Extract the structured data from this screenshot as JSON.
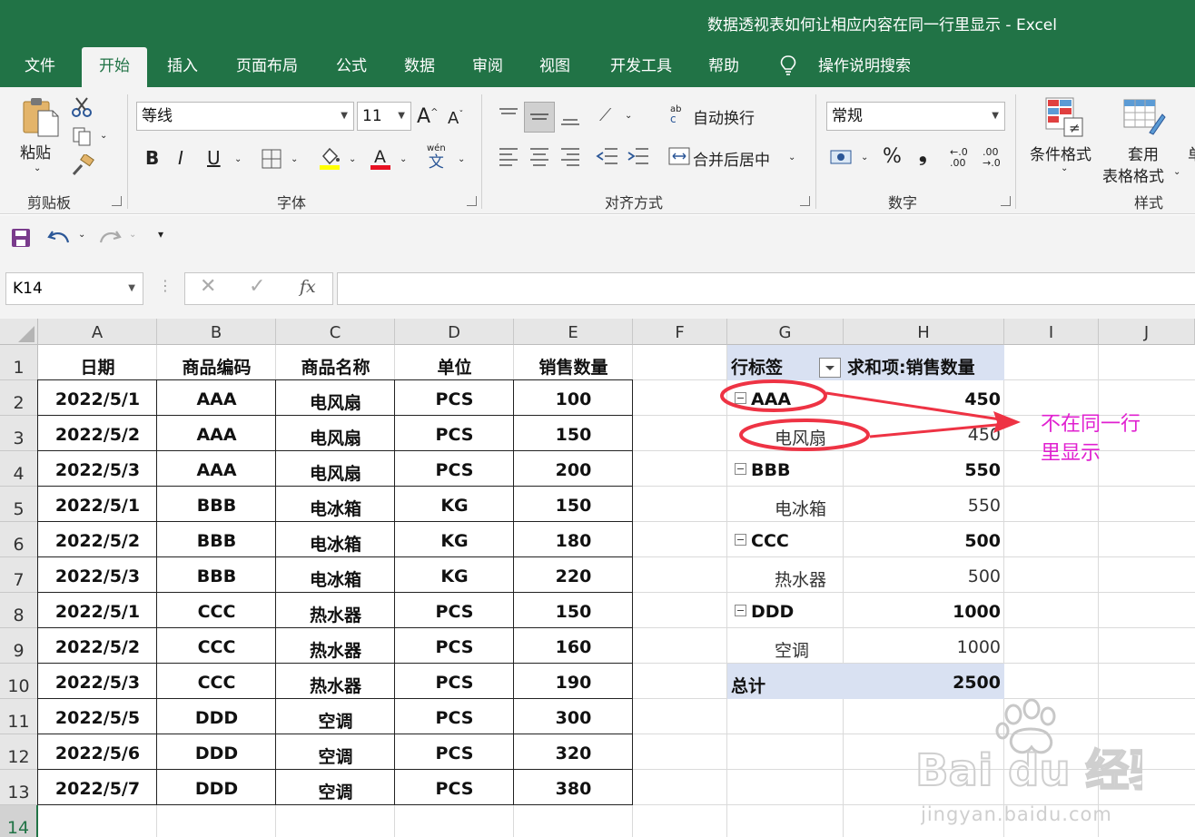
{
  "window": {
    "title": "数据透视表如何让相应内容在同一行里显示  -  Excel"
  },
  "tabs": [
    "文件",
    "开始",
    "插入",
    "页面布局",
    "公式",
    "数据",
    "审阅",
    "视图",
    "开发工具",
    "帮助"
  ],
  "tell_me": "操作说明搜索",
  "ribbon": {
    "clipboard": {
      "paste": "粘贴",
      "label": "剪贴板"
    },
    "font": {
      "name": "等线",
      "size": "11",
      "grow": "A",
      "shrink": "A",
      "bold": "B",
      "italic": "I",
      "underline": "U",
      "wen_top": "wén",
      "wen_bottom": "文",
      "label": "字体"
    },
    "alignment": {
      "wrap": "自动换行",
      "wrap_ab": "ab",
      "wrap_c": "c",
      "merge": "合并后居中",
      "label": "对齐方式"
    },
    "number": {
      "format": "常规",
      "percent": "%",
      "comma": "❟",
      "inc_top": "←.0",
      "inc_bottom": ".00",
      "dec_top": ".00",
      "dec_bottom": "→.0",
      "label": "数字"
    },
    "styles": {
      "conditional": "条件格式",
      "table_l1": "套用",
      "table_l2": "表格格式",
      "cell_partial": "单",
      "label": "样式"
    }
  },
  "formula_bar": {
    "name_box": "K14",
    "fx": "fx",
    "formula": ""
  },
  "columns": [
    "A",
    "B",
    "C",
    "D",
    "E",
    "F",
    "G",
    "H",
    "I",
    "J"
  ],
  "rows": [
    "1",
    "2",
    "3",
    "4",
    "5",
    "6",
    "7",
    "8",
    "9",
    "10",
    "11",
    "12",
    "13",
    "14"
  ],
  "table": {
    "headers": [
      "日期",
      "商品编码",
      "商品名称",
      "单位",
      "销售数量"
    ],
    "rows": [
      [
        "2022/5/1",
        "AAA",
        "电风扇",
        "PCS",
        "100"
      ],
      [
        "2022/5/2",
        "AAA",
        "电风扇",
        "PCS",
        "150"
      ],
      [
        "2022/5/3",
        "AAA",
        "电风扇",
        "PCS",
        "200"
      ],
      [
        "2022/5/1",
        "BBB",
        "电冰箱",
        "KG",
        "150"
      ],
      [
        "2022/5/2",
        "BBB",
        "电冰箱",
        "KG",
        "180"
      ],
      [
        "2022/5/3",
        "BBB",
        "电冰箱",
        "KG",
        "220"
      ],
      [
        "2022/5/1",
        "CCC",
        "热水器",
        "PCS",
        "150"
      ],
      [
        "2022/5/2",
        "CCC",
        "热水器",
        "PCS",
        "160"
      ],
      [
        "2022/5/3",
        "CCC",
        "热水器",
        "PCS",
        "190"
      ],
      [
        "2022/5/5",
        "DDD",
        "空调",
        "PCS",
        "300"
      ],
      [
        "2022/5/6",
        "DDD",
        "空调",
        "PCS",
        "320"
      ],
      [
        "2022/5/7",
        "DDD",
        "空调",
        "PCS",
        "380"
      ]
    ]
  },
  "pivot": {
    "row_label": "行标签",
    "value_label": "求和项:销售数量",
    "groups": [
      {
        "code": "AAA",
        "total": "450",
        "item": "电风扇",
        "value": "450"
      },
      {
        "code": "BBB",
        "total": "550",
        "item": "电冰箱",
        "value": "550"
      },
      {
        "code": "CCC",
        "total": "500",
        "item": "热水器",
        "value": "500"
      },
      {
        "code": "DDD",
        "total": "1000",
        "item": "空调",
        "value": "1000"
      }
    ],
    "grand_label": "总计",
    "grand_total": "2500"
  },
  "annotation": {
    "line1": "不在同一行",
    "line2": "里显示"
  },
  "watermark": {
    "logo": "Bai du 经验",
    "url": "jingyan.baidu.com"
  },
  "colors": {
    "excel_green": "#217346",
    "pivot_header": "#d9e1f2",
    "annotation_red": "#ee3344",
    "annotation_text": "#e020d0"
  }
}
